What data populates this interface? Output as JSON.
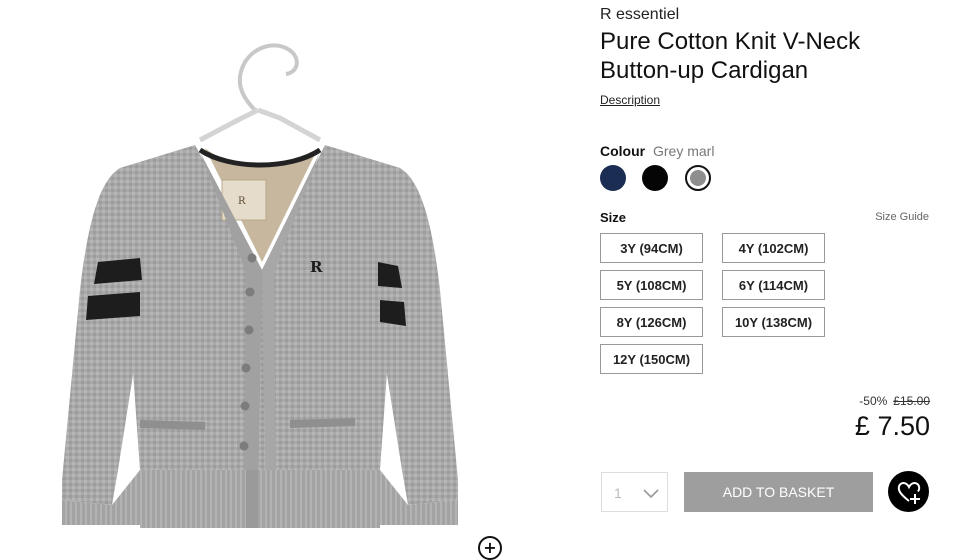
{
  "product": {
    "brand": "R essentiel",
    "title": "Pure Cotton Knit V-Neck Button-up Cardigan",
    "description_link": "Description",
    "image": {
      "alt": "Grey marl cardigan",
      "zoom_icon": "zoom-plus-icon",
      "monogram": "R"
    }
  },
  "colour": {
    "label": "Colour",
    "selected": "Grey marl",
    "swatches": [
      {
        "name": "Navy",
        "hex": "#1b2d52"
      },
      {
        "name": "Black",
        "hex": "#050505"
      },
      {
        "name": "Grey marl",
        "hex": "#8e8e8e"
      }
    ]
  },
  "size": {
    "label": "Size",
    "guide_link": "Size Guide",
    "options": [
      "3Y (94CM)",
      "4Y (102CM)",
      "5Y (108CM)",
      "6Y (114CM)",
      "8Y (126CM)",
      "10Y (138CM)",
      "12Y (150CM)"
    ]
  },
  "pricing": {
    "discount": "-50%",
    "old_price": "£15.00",
    "price": "£ 7.50"
  },
  "purchase": {
    "quantity": "1",
    "quantity_icon": "chevron-down-icon",
    "add_label": "ADD TO BASKET",
    "wishlist_icon": "heart-plus-icon"
  }
}
